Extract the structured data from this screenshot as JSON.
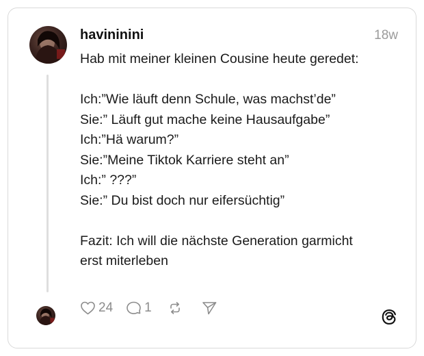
{
  "post": {
    "username": "havininini",
    "timestamp": "18w",
    "lines": [
      "Hab mit meiner kleinen Cousine heute geredet:",
      "",
      "Ich:”Wie läuft denn Schule, was machst’de”",
      "Sie:” Läuft gut mache keine Hausaufgabe”",
      "Ich:”Hä warum?”",
      "Sie:”Meine Tiktok Karriere steht an”",
      "Ich:” ???”",
      "Sie:” Du bist doch nur eifersüchtig”",
      "",
      "Fazit: Ich will die nächste Generation garmicht",
      "erst miterleben"
    ]
  },
  "actions": {
    "like_count": "24",
    "reply_count": "1"
  },
  "icons": {
    "like": "heart-icon",
    "reply": "comment-icon",
    "repost": "repost-icon",
    "share": "send-icon",
    "brand": "threads-logo-icon"
  },
  "colors": {
    "text": "#1a1a1a",
    "muted": "#8c8c8c",
    "border": "#d9d9d9",
    "thread_line": "#dedede"
  }
}
